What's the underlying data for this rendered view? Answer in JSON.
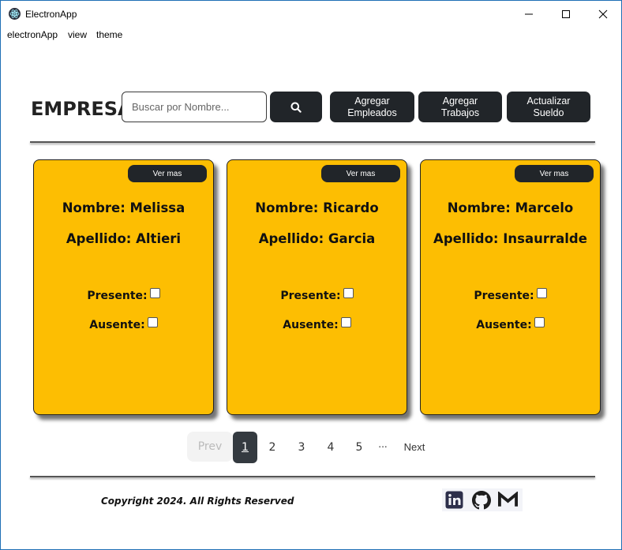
{
  "window": {
    "title": "ElectronApp"
  },
  "menu": [
    "electronApp",
    "view",
    "theme"
  ],
  "header": {
    "brand": "EMPRESA",
    "search_placeholder": "Buscar por Nombre...",
    "buttons": {
      "add_employees": [
        "Agregar",
        "Empleados"
      ],
      "add_jobs": [
        "Agregar",
        "Trabajos"
      ],
      "update_salary": [
        "Actualizar",
        "Sueldo"
      ]
    }
  },
  "cards": [
    {
      "button": "Ver mas",
      "nombre": "Nombre: Melissa",
      "apellido": "Apellido: Altieri",
      "presente": "Presente:",
      "ausente": "Ausente:"
    },
    {
      "button": "Ver mas",
      "nombre": "Nombre: Ricardo",
      "apellido": "Apellido: Garcia",
      "presente": "Presente:",
      "ausente": "Ausente:"
    },
    {
      "button": "Ver mas",
      "nombre": "Nombre: Marcelo",
      "apellido": "Apellido: Insaurralde",
      "presente": "Presente:",
      "ausente": "Ausente:"
    }
  ],
  "pagination": {
    "prev": "Prev",
    "pages": [
      "1",
      "2",
      "3",
      "4",
      "5"
    ],
    "ellipsis": "...",
    "next": "Next",
    "active_page": "1"
  },
  "footer": {
    "copyright": "Copyright 2024. All Rights Reserved",
    "social_icons": [
      "linkedin-icon",
      "github-icon",
      "gmail-icon"
    ]
  },
  "colors": {
    "card_bg": "#fdbe02",
    "dark_button": "#212529",
    "window_border": "#1f6fb5"
  }
}
